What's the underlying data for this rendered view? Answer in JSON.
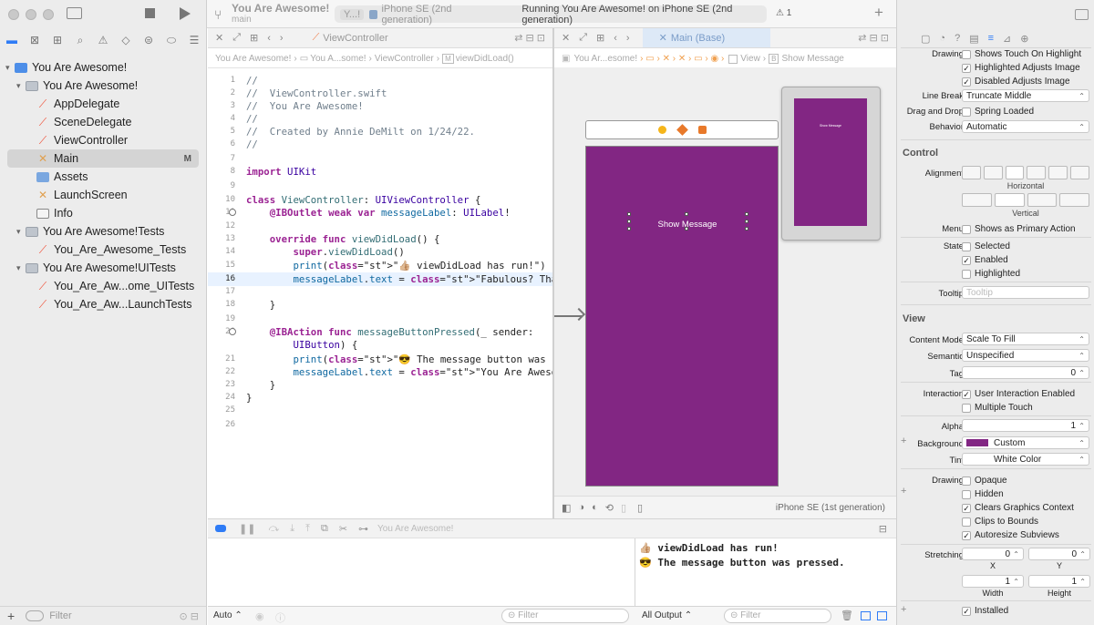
{
  "navigator": {
    "items": [
      {
        "label": "You Are Awesome!",
        "type": "project",
        "expanded": true
      },
      {
        "label": "You Are Awesome!",
        "type": "folder",
        "expanded": true
      },
      {
        "label": "AppDelegate",
        "type": "swift"
      },
      {
        "label": "SceneDelegate",
        "type": "swift"
      },
      {
        "label": "ViewController",
        "type": "swift"
      },
      {
        "label": "Main",
        "type": "storyboard",
        "badge": "M"
      },
      {
        "label": "Assets",
        "type": "assets"
      },
      {
        "label": "LaunchScreen",
        "type": "storyboard"
      },
      {
        "label": "Info",
        "type": "plist"
      },
      {
        "label": "You Are Awesome!Tests",
        "type": "folder",
        "expanded": true
      },
      {
        "label": "You_Are_Awesome_Tests",
        "type": "swift"
      },
      {
        "label": "You Are Awesome!UITests",
        "type": "folder",
        "expanded": true
      },
      {
        "label": "You_Are_Aw...ome_UITests",
        "type": "swift"
      },
      {
        "label": "You_Are_Aw...LaunchTests",
        "type": "swift"
      }
    ],
    "filter_placeholder": "Filter"
  },
  "toolbar": {
    "project": "You Are Awesome!",
    "branch": "main",
    "scheme": "Y...!",
    "device": "iPhone SE (2nd generation)",
    "status": "Running You Are Awesome! on iPhone SE (2nd generation)",
    "warnings": "1"
  },
  "editor_left": {
    "tab": "ViewController",
    "jump": [
      "You Are Awesome!",
      "You A...some!",
      "ViewController",
      "viewDidLoad()"
    ],
    "lines": [
      {
        "n": "1",
        "t": "//"
      },
      {
        "n": "2",
        "t": "//  ViewController.swift"
      },
      {
        "n": "3",
        "t": "//  You Are Awesome!"
      },
      {
        "n": "4",
        "t": "//"
      },
      {
        "n": "5",
        "t": "//  Created by Annie DeMilt on 1/24/22."
      },
      {
        "n": "6",
        "t": "//"
      },
      {
        "n": "7",
        "t": ""
      },
      {
        "n": "8",
        "t": "import UIKit"
      },
      {
        "n": "9",
        "t": ""
      },
      {
        "n": "10",
        "t": "class ViewController: UIViewController {"
      },
      {
        "n": "11",
        "t": "    @IBOutlet weak var messageLabel: UILabel!"
      },
      {
        "n": "12",
        "t": ""
      },
      {
        "n": "13",
        "t": "    override func viewDidLoad() {"
      },
      {
        "n": "14",
        "t": "        super.viewDidLoad()"
      },
      {
        "n": "15",
        "t": "        print(\"👍🏼 viewDidLoad has run!\")"
      },
      {
        "n": "16",
        "t": "        messageLabel.text = \"Fabulous? That's You!\""
      },
      {
        "n": "17",
        "t": ""
      },
      {
        "n": "18",
        "t": "    }"
      },
      {
        "n": "19",
        "t": ""
      },
      {
        "n": "20",
        "t": "    @IBAction func messageButtonPressed(_ sender:"
      },
      {
        "n": "",
        "t": "        UIButton) {"
      },
      {
        "n": "21",
        "t": "        print(\"😎 The message button was pressed.\")"
      },
      {
        "n": "22",
        "t": "        messageLabel.text = \"You Are Awesome!\""
      },
      {
        "n": "23",
        "t": "    }"
      },
      {
        "n": "24",
        "t": "}"
      },
      {
        "n": "25",
        "t": ""
      },
      {
        "n": "26",
        "t": ""
      }
    ]
  },
  "editor_right": {
    "tab": "Main (Base)",
    "jump": [
      "You Ar...esome!",
      "View",
      "Show Message"
    ],
    "button_title": "Show Message",
    "device_label": "iPhone SE (1st generation)",
    "view_color": "#822683"
  },
  "debug": {
    "target": "You Are Awesome!",
    "console": [
      "👍🏼 viewDidLoad has run!",
      "😎 The message button was pressed."
    ],
    "variables_scope": "Auto",
    "output_filter": "All Output",
    "filter_placeholder": "Filter"
  },
  "inspector": {
    "button_drawing": {
      "label": "Drawing",
      "opts": [
        {
          "t": "Shows Touch On Highlight",
          "on": false
        },
        {
          "t": "Highlighted Adjusts Image",
          "on": true
        },
        {
          "t": "Disabled Adjusts Image",
          "on": true
        }
      ]
    },
    "line_break": {
      "label": "Line Break",
      "value": "Truncate Middle"
    },
    "drag_drop": {
      "label": "Drag and Drop",
      "opt": "Spring Loaded"
    },
    "behavior": {
      "label": "Behavior",
      "value": "Automatic"
    },
    "control_title": "Control",
    "alignment_label": "Alignment",
    "horizontal": "Horizontal",
    "vertical": "Vertical",
    "menu": {
      "label": "Menu",
      "opt": "Shows as Primary Action"
    },
    "state": {
      "label": "State",
      "opts": [
        {
          "t": "Selected",
          "on": false
        },
        {
          "t": "Enabled",
          "on": true
        },
        {
          "t": "Highlighted",
          "on": false
        }
      ]
    },
    "tooltip": {
      "label": "Tooltip",
      "placeholder": "Tooltip"
    },
    "view_title": "View",
    "content_mode": {
      "label": "Content Mode",
      "value": "Scale To Fill"
    },
    "semantic": {
      "label": "Semantic",
      "value": "Unspecified"
    },
    "tag": {
      "label": "Tag",
      "value": "0"
    },
    "interaction": {
      "label": "Interaction",
      "opts": [
        {
          "t": "User Interaction Enabled",
          "on": true
        },
        {
          "t": "Multiple Touch",
          "on": false
        }
      ]
    },
    "alpha": {
      "label": "Alpha",
      "value": "1"
    },
    "background": {
      "label": "Background",
      "value": "Custom",
      "color": "#822683"
    },
    "tint": {
      "label": "Tint",
      "value": "White Color"
    },
    "view_drawing": {
      "label": "Drawing",
      "opts": [
        {
          "t": "Opaque",
          "on": false
        },
        {
          "t": "Hidden",
          "on": false
        },
        {
          "t": "Clears Graphics Context",
          "on": true
        },
        {
          "t": "Clips to Bounds",
          "on": false
        },
        {
          "t": "Autoresize Subviews",
          "on": true
        }
      ]
    },
    "stretching": {
      "label": "Stretching",
      "x": "0",
      "y": "0",
      "w": "1",
      "h": "1",
      "xl": "X",
      "yl": "Y",
      "wl": "Width",
      "hl": "Height"
    },
    "installed": "Installed"
  }
}
